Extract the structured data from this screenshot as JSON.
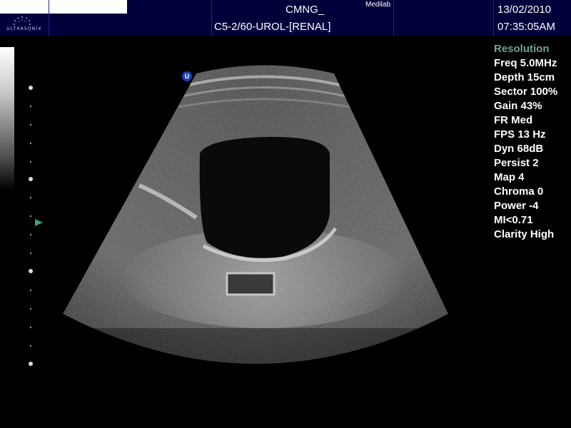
{
  "header": {
    "logo_text": "ULTRASONIX",
    "title": "CMNG_",
    "institution": "Medilab",
    "probe_preset": "C5-2/60-UROL-[RENAL]",
    "date": "13/02/2010",
    "time": "07:35:05AM"
  },
  "image": {
    "orientation_marker": "U"
  },
  "params": {
    "header": "Resolution",
    "rows": [
      "Freq 5.0MHz",
      "Depth 15cm",
      "Sector 100%",
      "Gain 43%",
      "FR Med",
      "FPS 13 Hz",
      "Dyn 68dB",
      "Persist 2",
      "Map 4",
      "Chroma 0",
      "Power -4",
      "MI<0.71",
      "Clarity High"
    ]
  },
  "colors": {
    "header_bg": "#00003a",
    "param_header": "#6fa58c",
    "focus_marker": "#3fa07a",
    "orientation_marker": "#1a3fb8"
  }
}
